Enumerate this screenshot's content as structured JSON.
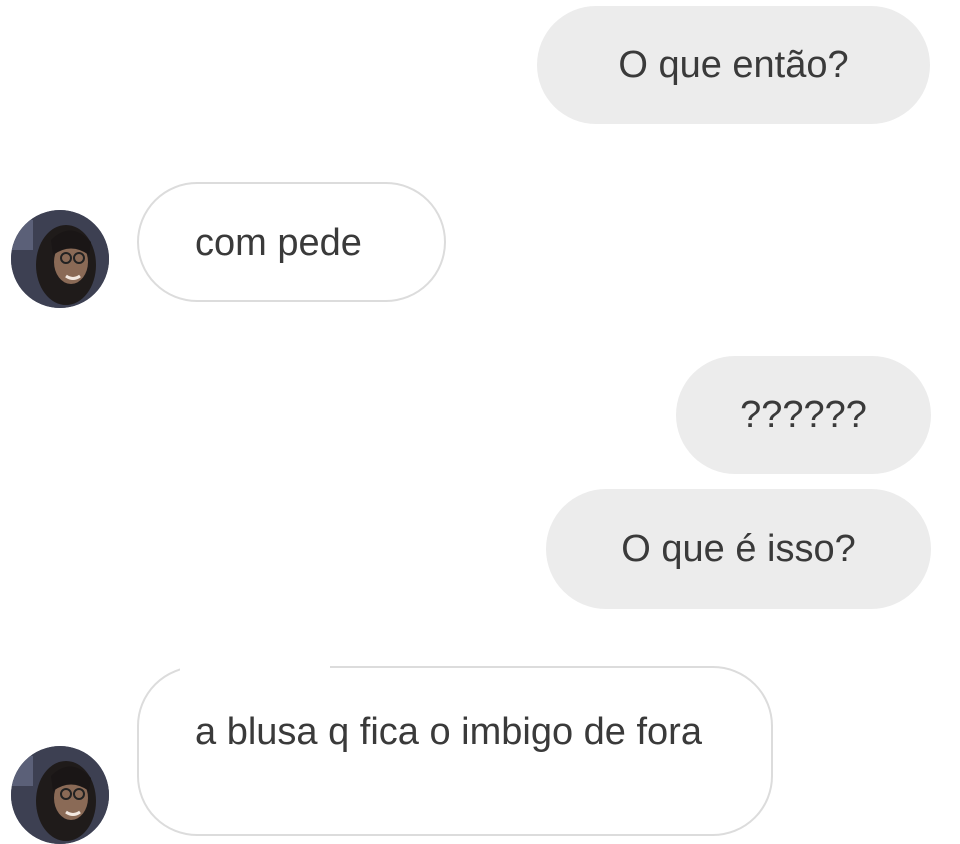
{
  "messages": [
    {
      "direction": "outgoing",
      "text": "O que então?"
    },
    {
      "direction": "incoming",
      "text": "com pede"
    },
    {
      "direction": "outgoing",
      "text": "??????"
    },
    {
      "direction": "outgoing",
      "text": "O que é isso?"
    },
    {
      "direction": "incoming",
      "text": "a blusa q fica o imbigo de fora"
    }
  ],
  "colors": {
    "outgoing_bubble": "#ececec",
    "incoming_border": "#dcdcdc",
    "text": "#3a3a3a"
  }
}
